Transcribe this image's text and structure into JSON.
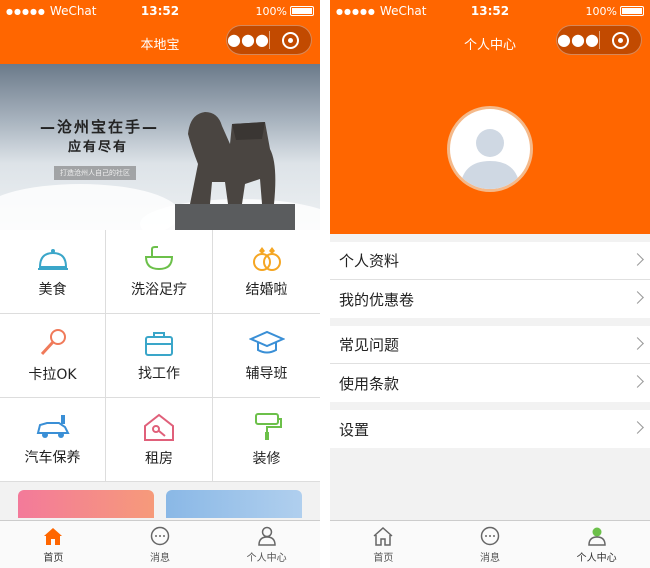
{
  "status_bar": {
    "carrier": "WeChat",
    "time": "13:52",
    "battery": "100%"
  },
  "left": {
    "nav_title": "本地宝",
    "banner": {
      "title_line1": "—沧州宝在手—",
      "title_line2": "应有尽有",
      "tagline": "打造沧州人自己的社区"
    },
    "grid": [
      {
        "label": "美食",
        "icon": "food-cloche-icon",
        "color": "#3aa6c9"
      },
      {
        "label": "洗浴足疗",
        "icon": "bathtub-icon",
        "color": "#6cc04a"
      },
      {
        "label": "结婚啦",
        "icon": "wedding-rings-icon",
        "color": "#f5a623"
      },
      {
        "label": "卡拉OK",
        "icon": "microphone-icon",
        "color": "#f07a5a"
      },
      {
        "label": "找工作",
        "icon": "briefcase-icon",
        "color": "#3aa6c9"
      },
      {
        "label": "辅导班",
        "icon": "graduation-cap-icon",
        "color": "#3a8fd6"
      },
      {
        "label": "汽车保养",
        "icon": "car-service-icon",
        "color": "#3a8fd6"
      },
      {
        "label": "租房",
        "icon": "house-key-icon",
        "color": "#e0607a"
      },
      {
        "label": "装修",
        "icon": "paint-roller-icon",
        "color": "#6cc04a"
      }
    ],
    "tabs": [
      {
        "label": "首页",
        "icon": "home-icon",
        "active": true
      },
      {
        "label": "消息",
        "icon": "message-icon",
        "active": false
      },
      {
        "label": "个人中心",
        "icon": "user-icon",
        "active": false
      }
    ]
  },
  "right": {
    "nav_title": "个人中心",
    "menu_groups": [
      [
        "个人资料",
        "我的优惠卷"
      ],
      [
        "常见问题",
        "使用条款"
      ],
      [
        "设置"
      ]
    ],
    "tabs": [
      {
        "label": "首页",
        "icon": "home-icon",
        "active": false
      },
      {
        "label": "消息",
        "icon": "message-icon",
        "active": false
      },
      {
        "label": "个人中心",
        "icon": "user-icon",
        "active": true
      }
    ]
  },
  "colors": {
    "brand": "#ff6600",
    "active_tab_home": "#ff6600",
    "active_tab_user": "#6cc04a"
  }
}
